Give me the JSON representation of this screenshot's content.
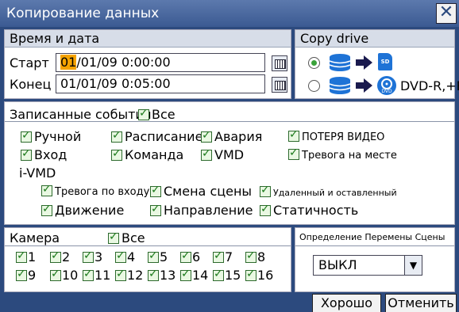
{
  "window": {
    "title": "Копирование данных"
  },
  "datetime": {
    "header": "Время и дата",
    "start_label": "Старт",
    "start_highlight": "01",
    "start_value": "/01/09  0:00:00",
    "end_label": "Конец",
    "end_value": "01/01/09  0:05:00"
  },
  "copy_drive": {
    "header": "Copy drive",
    "dvd_label": "DVD-R,+R",
    "sd_text": "SD",
    "dvd_text": "DVD"
  },
  "events": {
    "header": "Записанные события",
    "all": "Все",
    "items": [
      "Ручной",
      "Расписание",
      "Авария",
      "ПОТЕРЯ ВИДЕО",
      "Вход",
      "Команда",
      "VMD",
      "Тревога на месте"
    ],
    "ivmd_header": "i-VMD",
    "ivmd_items": [
      "Тревога по входу",
      "Смена сцены",
      "Удаленный и оставленный",
      "Движение",
      "Направление",
      "Статичность"
    ]
  },
  "camera": {
    "header": "Камера",
    "all": "Все",
    "numbers": [
      "1",
      "2",
      "3",
      "4",
      "5",
      "6",
      "7",
      "8",
      "9",
      "10",
      "11",
      "12",
      "13",
      "14",
      "15",
      "16"
    ]
  },
  "scene_change": {
    "header": "Определение Перемены Сцены",
    "value": "ВЫКЛ"
  },
  "buttons": {
    "ok": "Хорошо",
    "cancel": "Отменить"
  }
}
